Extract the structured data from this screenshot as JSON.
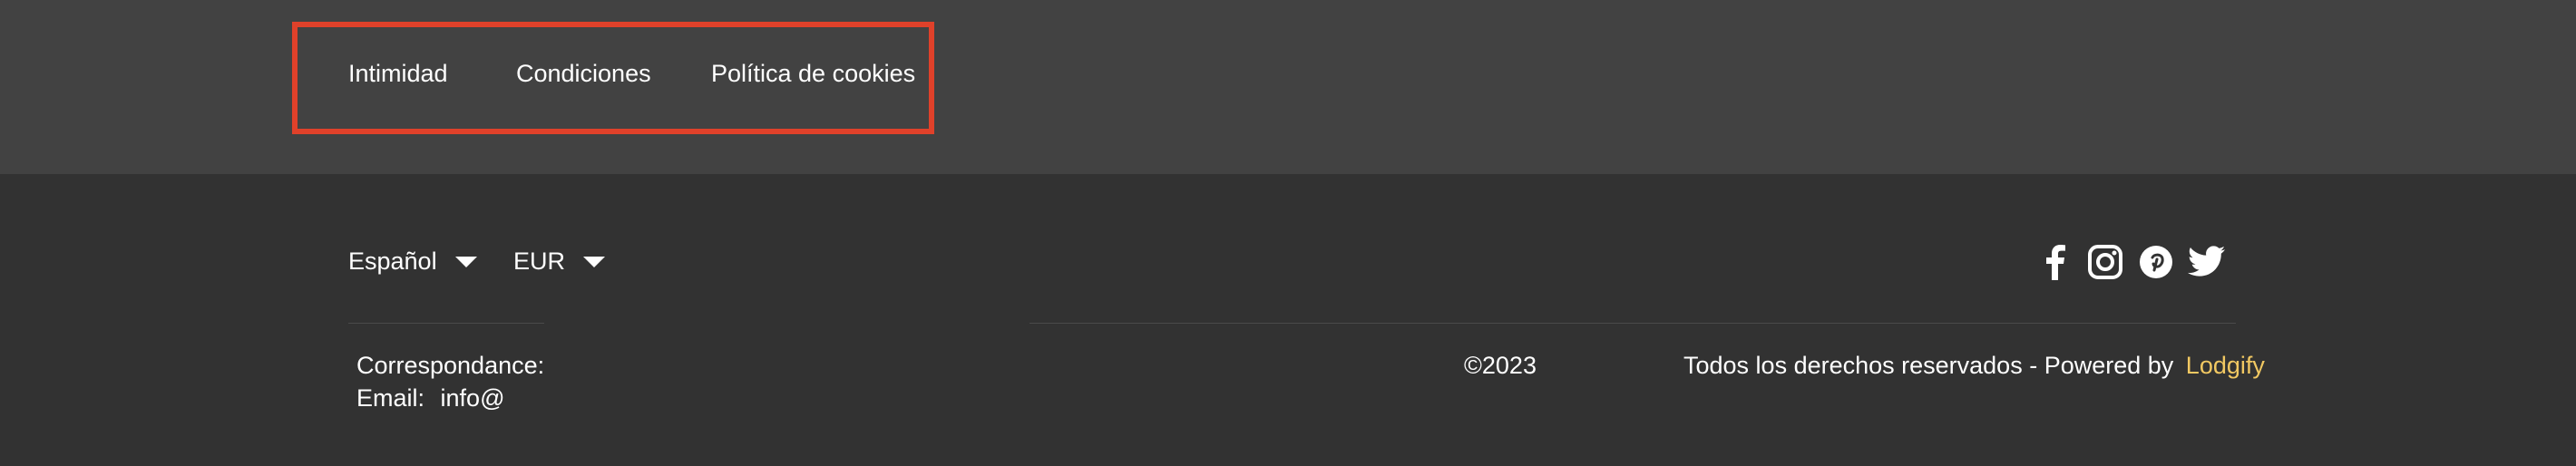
{
  "legal_nav": {
    "items": [
      {
        "label": "Intimidad"
      },
      {
        "label": "Condiciones"
      },
      {
        "label": "Política de cookies"
      }
    ]
  },
  "selectors": {
    "language": "Español",
    "currency": "EUR"
  },
  "contact": {
    "label": "Correspondance:",
    "email_label": "Email:",
    "email_value": "info@"
  },
  "copyright": "©2023",
  "rights": {
    "text": "Todos los derechos reservados - Powered by",
    "brand": "Lodgify",
    "brand_color": "#f1c862"
  },
  "social_icons": [
    "facebook-icon",
    "instagram-icon",
    "pinterest-icon",
    "twitter-icon"
  ],
  "colors": {
    "highlight_border": "#e0412a",
    "top_band": "#424242",
    "footer_bg": "#323232"
  }
}
